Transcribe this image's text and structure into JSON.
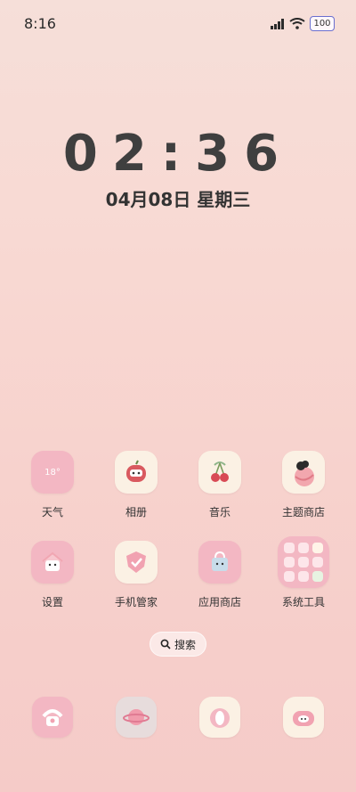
{
  "status_bar": {
    "time": "8:16",
    "battery": "100"
  },
  "clock": {
    "time": "02:36",
    "date": "04月08日 星期三"
  },
  "weather_widget_text": "18°",
  "apps_row1": [
    {
      "label": "天气",
      "icon": "weather-icon"
    },
    {
      "label": "相册",
      "icon": "gallery-icon"
    },
    {
      "label": "音乐",
      "icon": "music-icon"
    },
    {
      "label": "主题商店",
      "icon": "theme-store-icon"
    }
  ],
  "apps_row2": [
    {
      "label": "设置",
      "icon": "settings-icon"
    },
    {
      "label": "手机管家",
      "icon": "phone-manager-icon"
    },
    {
      "label": "应用商店",
      "icon": "app-store-icon"
    },
    {
      "label": "系统工具",
      "icon": "system-tools-folder-icon"
    }
  ],
  "search": {
    "label": "搜索"
  },
  "dock": [
    {
      "icon": "phone-icon"
    },
    {
      "icon": "browser-planet-icon"
    },
    {
      "icon": "messages-icon"
    },
    {
      "icon": "camera-icon"
    }
  ],
  "colors": {
    "background_top": "#f6dfd9",
    "background_bottom": "#f5cbc8",
    "accent_pink": "#f4b7c2"
  }
}
